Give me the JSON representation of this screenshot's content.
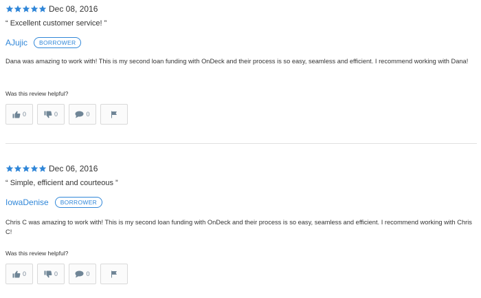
{
  "colors": {
    "accent": "#2f86d8",
    "star": "#2f86d8",
    "icon": "#6f8596"
  },
  "helpful_label": "Was this review helpful?",
  "reviews": [
    {
      "stars": 5,
      "date": "Dec 08, 2016",
      "title": "“ Excellent customer service! ”",
      "author": "AJujic",
      "badge": "BORROWER",
      "body": "Dana was amazing to work with! This is my second loan funding with OnDeck and their process is so easy, seamless and efficient. I recommend working with Dana!",
      "helpful_count": "0",
      "unhelpful_count": "0",
      "comment_count": "0"
    },
    {
      "stars": 5,
      "date": "Dec 06, 2016",
      "title": "“ Simple, efficient and courteous ”",
      "author": "IowaDenise",
      "badge": "BORROWER",
      "body": "Chris C was amazing to work with! This is my second loan funding with OnDeck and their process is so easy, seamless and efficient. I recommend working with Chris C!",
      "helpful_count": "0",
      "unhelpful_count": "0",
      "comment_count": "0"
    }
  ]
}
